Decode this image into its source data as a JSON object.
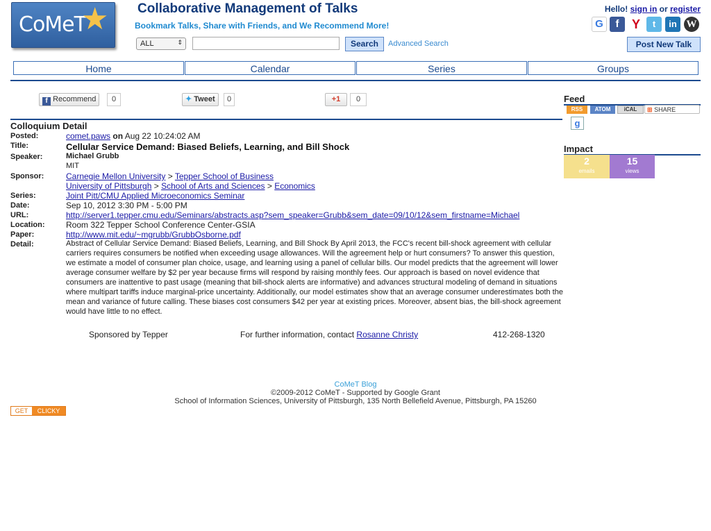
{
  "header": {
    "logo_text": "CoMeT",
    "site_title": "Collaborative Management of Talks",
    "tagline": "Bookmark Talks, Share with Friends, and We Recommend More!",
    "scope_value": "ALL",
    "search_button": "Search",
    "advanced_search": "Advanced Search",
    "hello": "Hello!",
    "sign_in": "sign in",
    "or": "or",
    "register": "register",
    "post_new_talk": "Post New Talk",
    "social_icons": [
      "google-icon",
      "facebook-icon",
      "yahoo-icon",
      "twitter-icon",
      "linkedin-icon",
      "wordpress-icon"
    ]
  },
  "nav": {
    "items": [
      "Home",
      "Calendar",
      "Series",
      "Groups"
    ]
  },
  "share": {
    "recommend_label": "Recommend",
    "recommend_count": "0",
    "tweet_label": "Tweet",
    "tweet_count": "0",
    "gplus_label": "+1",
    "gplus_count": "0"
  },
  "detail": {
    "heading": "Colloquium Detail",
    "labels": {
      "posted": "Posted:",
      "title": "Title:",
      "speaker": "Speaker:",
      "sponsor": "Sponsor:",
      "series": "Series:",
      "date": "Date:",
      "url": "URL:",
      "location": "Location:",
      "paper": "Paper:",
      "detail": "Detail:"
    },
    "posted_by": "comet.paws",
    "posted_on": "on",
    "posted_date": "Aug 22 10:24:02 AM",
    "title": "Cellular Service Demand: Biased Beliefs, Learning, and Bill Shock",
    "speaker_name": "Michael Grubb",
    "speaker_affiliation": "MIT",
    "sponsor_1": [
      "Carnegie Mellon University",
      "Tepper School of Business"
    ],
    "sponsor_2": [
      "University of Pittsburgh",
      "School of Arts and Sciences",
      "Economics"
    ],
    "separator": ">",
    "series": "Joint Pitt/CMU Applied Microeconomics Seminar",
    "date": "Sep 10, 2012 3:30 PM - 5:00 PM",
    "url": "http://server1.tepper.cmu.edu/Seminars/abstracts.asp?sem_speaker=Grubb&sem_date=09/10/12&sem_firstname=Michael",
    "location": "Room 322 Tepper School Conference Center-GSIA",
    "paper": "http://www.mit.edu/~mgrubb/GrubbOsborne.pdf",
    "abstract": "Abstract of Cellular Service Demand: Biased Beliefs, Learning, and Bill Shock By April 2013, the FCC's recent bill-shock agreement with cellular carriers requires consumers be notified when exceeding usage allowances. Will the agreement help or hurt consumers? To answer this question, we estimate a model of consumer plan choice, usage, and learning using a panel of cellular bills. Our model predicts that the agreement will lower average consumer welfare by $2 per year because firms will respond by raising monthly fees. Our approach is based on novel evidence that consumers are inattentive to past usage (meaning that bill-shock alerts are informative) and advances structural modeling of demand in situations where multipart tariffs induce marginal-price uncertainty. Additionally, our model estimates show that an average consumer underestimates both the mean and variance of future calling. These biases cost consumers $42 per year at existing prices. Moreover, absent bias, the bill-shock agreement would have little to no effect.",
    "sponsored_by": "Sponsored by Tepper",
    "further_info": "For further information, contact",
    "contact_name": "Rosanne Christy",
    "contact_phone": "412-268-1320"
  },
  "sidebar": {
    "feed_heading": "Feed",
    "feed_badges": [
      "RSS",
      "ATOM",
      "iCAL",
      "SHARE"
    ],
    "impact_heading": "Impact",
    "emails_count": "2",
    "emails_label": "emails",
    "views_count": "15",
    "views_label": "views"
  },
  "footer": {
    "blog": "CoMeT Blog",
    "copyright": "©2009-2012 CoMeT - Supported by Google Grant",
    "address": "School of Information Sciences, University of Pittsburgh, 135 North Bellefield Avenue, Pittsburgh, PA 15260",
    "getclicky_1": "GET",
    "getclicky_2": "CLICKY"
  },
  "colors": {
    "brand_blue": "#123a7a",
    "accent_blue": "#1f8ad0",
    "emails_tile": "#f5e08d",
    "views_tile": "#a27ad1"
  }
}
